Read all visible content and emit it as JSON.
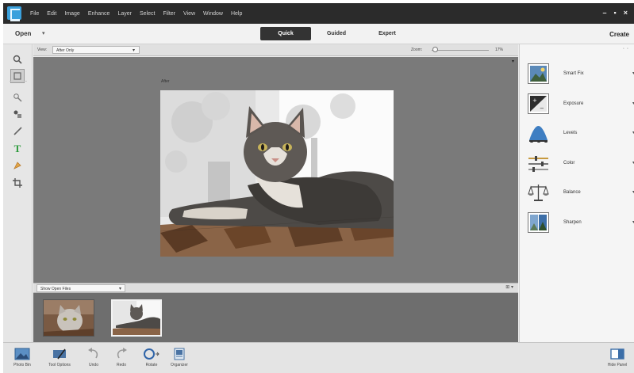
{
  "menubar": {
    "app_icon": "photoshop-elements-logo",
    "menus": [
      "File",
      "Edit",
      "Image",
      "Enhance",
      "Layer",
      "Select",
      "Filter",
      "View",
      "Window",
      "Help"
    ],
    "window_controls": [
      "–",
      "▪",
      "×"
    ]
  },
  "modebar": {
    "open_label": "Open",
    "open_caret": "▾",
    "modes": [
      {
        "label": "Quick",
        "active": true
      },
      {
        "label": "Guided",
        "active": false
      },
      {
        "label": "Expert",
        "active": false
      }
    ],
    "create_label": "Create"
  },
  "toolbox": {
    "tools": [
      "zoom-icon",
      "hand-icon",
      "quick-selection-icon",
      "eye-icon",
      "whiten-teeth-icon",
      "type-icon",
      "spot-healing-icon",
      "crop-icon"
    ]
  },
  "viewbar": {
    "view_label": "View:",
    "view_value": "After Only",
    "zoom_label": "Zoom:",
    "zoom_value": "17%",
    "zoom_level": 0.02
  },
  "canvas": {
    "after_label": "After"
  },
  "bin": {
    "selector_value": "Show Open Files",
    "thumbnails": [
      "thumbnail-cat-portrait",
      "thumbnail-cat-lying"
    ],
    "selected_index": 1
  },
  "adjustments": [
    {
      "label": "Smart Fix",
      "icon": "smart-fix-icon"
    },
    {
      "label": "Exposure",
      "icon": "exposure-icon"
    },
    {
      "label": "Levels",
      "icon": "levels-icon"
    },
    {
      "label": "Color",
      "icon": "color-icon"
    },
    {
      "label": "Balance",
      "icon": "balance-icon"
    },
    {
      "label": "Sharpen",
      "icon": "sharpen-icon"
    }
  ],
  "taskbar": {
    "items": [
      {
        "label": "Photo Bin",
        "icon": "photo-bin-icon"
      },
      {
        "label": "Tool Options",
        "icon": "tool-options-icon"
      },
      {
        "label": "Undo",
        "icon": "undo-icon"
      },
      {
        "label": "Redo",
        "icon": "redo-icon"
      },
      {
        "label": "Rotate",
        "icon": "rotate-icon"
      },
      {
        "label": "Organizer",
        "icon": "organizer-icon"
      }
    ],
    "hide_panel_label": "Hide Panel"
  },
  "colors": {
    "menubar_bg": "#2b2b2b",
    "active_mode_bg": "#333333",
    "canvas_bg": "#7a7a7a",
    "bin_bg": "#6e6e6e",
    "panel_bg": "#f5f5f5",
    "accent_blue": "#3aa0dc"
  }
}
